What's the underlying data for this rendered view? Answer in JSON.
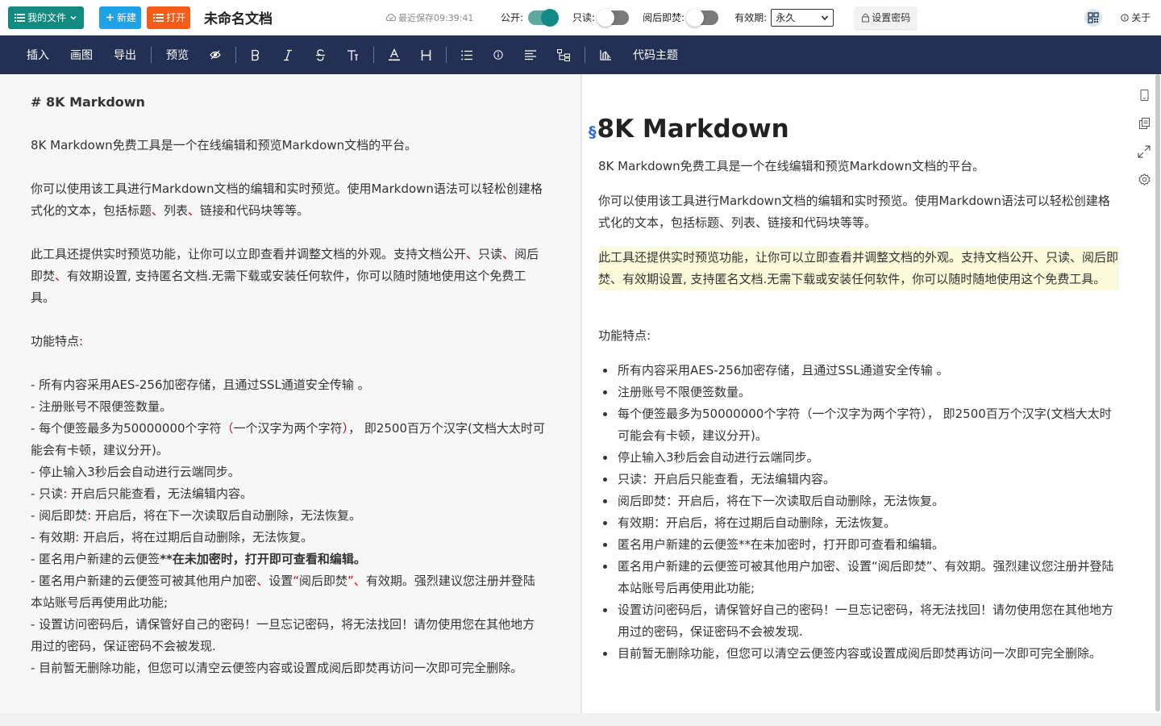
{
  "header": {
    "my_files": "我的文件",
    "new": "新建",
    "open": "打开",
    "doc_title": "未命名文档",
    "saved": "最近保存09:39:41",
    "public_label": "公开:",
    "public_on": true,
    "readonly_label": "只读:",
    "readonly_on": false,
    "burn_label": "阅后即焚:",
    "burn_on": false,
    "expire_label": "有效期:",
    "expire_value": "永久",
    "password_btn": "设置密码",
    "about": "关于"
  },
  "toolbar": {
    "insert": "插入",
    "draw": "画图",
    "export": "导出",
    "preview": "预览",
    "code_theme": "代码主题"
  },
  "editor": {
    "heading": "# 8K Markdown",
    "intro": "8K Markdown免费工具是一个在线编辑和预览Markdown文档的平台。",
    "p2_a": "你可以使用该工具进行Markdown文档的编辑和实时预览。使用Markdown语法可以轻松创建格式化的文本，包括标题",
    "p2_s1": "、",
    "p2_b": "列表",
    "p2_s2": "、",
    "p2_c": "链接和代码块等等。",
    "p3_a": "此工具还提供实时预览功能，让你可以立即查看并调整文档的外观。支持文档公开",
    "p3_s1": "、",
    "p3_b": "只读",
    "p3_s2": "、",
    "p3_c": "阅后即焚",
    "p3_s3": "、",
    "p3_d": "有效期设置, 支持匿名文档.无需下载或安装任何软件，你可以随时随地使用这个免费工具。",
    "features_a": "功能特点",
    "features_colon": ":",
    "l1": "- 所有内容采用AES-256加密存储，且通过SSL通道安全传输 。",
    "l2": "- 注册账号不限便签数量。",
    "l3_a": "- 每个便签最多为50000000个字符",
    "l3_p1": "（",
    "l3_b": "一个汉字为两个字符",
    "l3_p2": "）",
    "l3_c": "， 即2500百万个汉字(文档大太时可能会有卡顿，建议分开)。",
    "l4": "- 停止输入3秒后会自动进行云端同步。",
    "l5_a": "- 只读",
    "l5_c": ":",
    "l5_b": " 开启后只能查看，无法编辑内容。",
    "l6_a": "- 阅后即焚",
    "l6_c": ":",
    "l6_b": " 开启后，将在下一次读取后自动删除，无法恢复。",
    "l7_a": "- 有效期",
    "l7_c": ":",
    "l7_b": " 开启后，将在过期后自动删除，无法恢复。",
    "l8_a": "- 匿名用户新建的云便签",
    "l8_b": "**在未加密时，打开即可查看和编辑。",
    "l9_a": "- 匿名用户新建的云便签可被其他用户加密",
    "l9_s1": "、",
    "l9_b": "设置",
    "l9_q1": "“",
    "l9_c": "阅后即焚",
    "l9_q2": "”",
    "l9_s2": "、",
    "l9_d": "有效期。强烈建议您注册并登陆本站账号后再使用此功能;",
    "l10": "- 设置访问密码后，请保管好自己的密码！一旦忘记密码，将无法找回！请勿使用您在其他地方用过的密码，保证密码不会被发现.",
    "l11": "- 目前暂无删除功能，但您可以清空云便签内容或设置成阅后即焚再访问一次即可完全删除。"
  },
  "preview": {
    "anchor": "§",
    "h1": "8K Markdown",
    "intro": "8K Markdown免费工具是一个在线编辑和预览Markdown文档的平台。",
    "p2": "你可以使用该工具进行Markdown文档的编辑和实时预览。使用Markdown语法可以轻松创建格式化的文本，包括标题、列表、链接和代码块等等。",
    "p3": "此工具还提供实时预览功能，让你可以立即查看并调整文档的外观。支持文档公开、只读、阅后即焚、有效期设置, 支持匿名文档.无需下载或安装任何软件，你可以随时随地使用这个免费工具。",
    "features": "功能特点:",
    "items": [
      "所有内容采用AES-256加密存储，且通过SSL通道安全传输 。",
      "注册账号不限便签数量。",
      "每个便签最多为50000000个字符（一个汉字为两个字符）， 即2500百万个汉字(文档大太时可能会有卡顿，建议分开)。",
      "停止输入3秒后会自动进行云端同步。",
      "只读：开启后只能查看，无法编辑内容。",
      "阅后即焚：开启后，将在下一次读取后自动删除，无法恢复。",
      "有效期：开启后，将在过期后自动删除，无法恢复。",
      "匿名用户新建的云便签**在未加密时，打开即可查看和编辑。",
      "匿名用户新建的云便签可被其他用户加密、设置“阅后即焚”、有效期。强烈建议您注册并登陆本站账号后再使用此功能;",
      "设置访问密码后，请保管好自己的密码！一旦忘记密码，将无法找回！请勿使用您在其他地方用过的密码，保证密码不会被发现.",
      "目前暂无删除功能，但您可以清空云便签内容或设置成阅后即焚再访问一次即可完全删除。"
    ]
  },
  "colors": {
    "accent": "#138a80",
    "toolbar_bg": "#223153",
    "new_btn": "#1ea1e6",
    "open_btn": "#f75b18",
    "highlight_bg": "#fbfbdc",
    "red_punct": "#d6001c"
  },
  "icons": {
    "files": "list-icon",
    "new": "plus-icon",
    "open": "open-list-icon",
    "saved": "cloud-check-icon",
    "password": "lock-icon",
    "qr": "qr-code-icon",
    "about": "info-icon",
    "toolbar": [
      "eye-icon",
      "bold-icon",
      "italic-icon",
      "strikethrough-icon",
      "font-size-icon",
      "font-color-icon",
      "heading-icon",
      "list-icon",
      "info-icon",
      "align-icon",
      "tree-icon",
      "chart-icon"
    ],
    "side": [
      "mobile-icon",
      "copy-icon",
      "fullscreen-icon",
      "settings-icon"
    ]
  }
}
